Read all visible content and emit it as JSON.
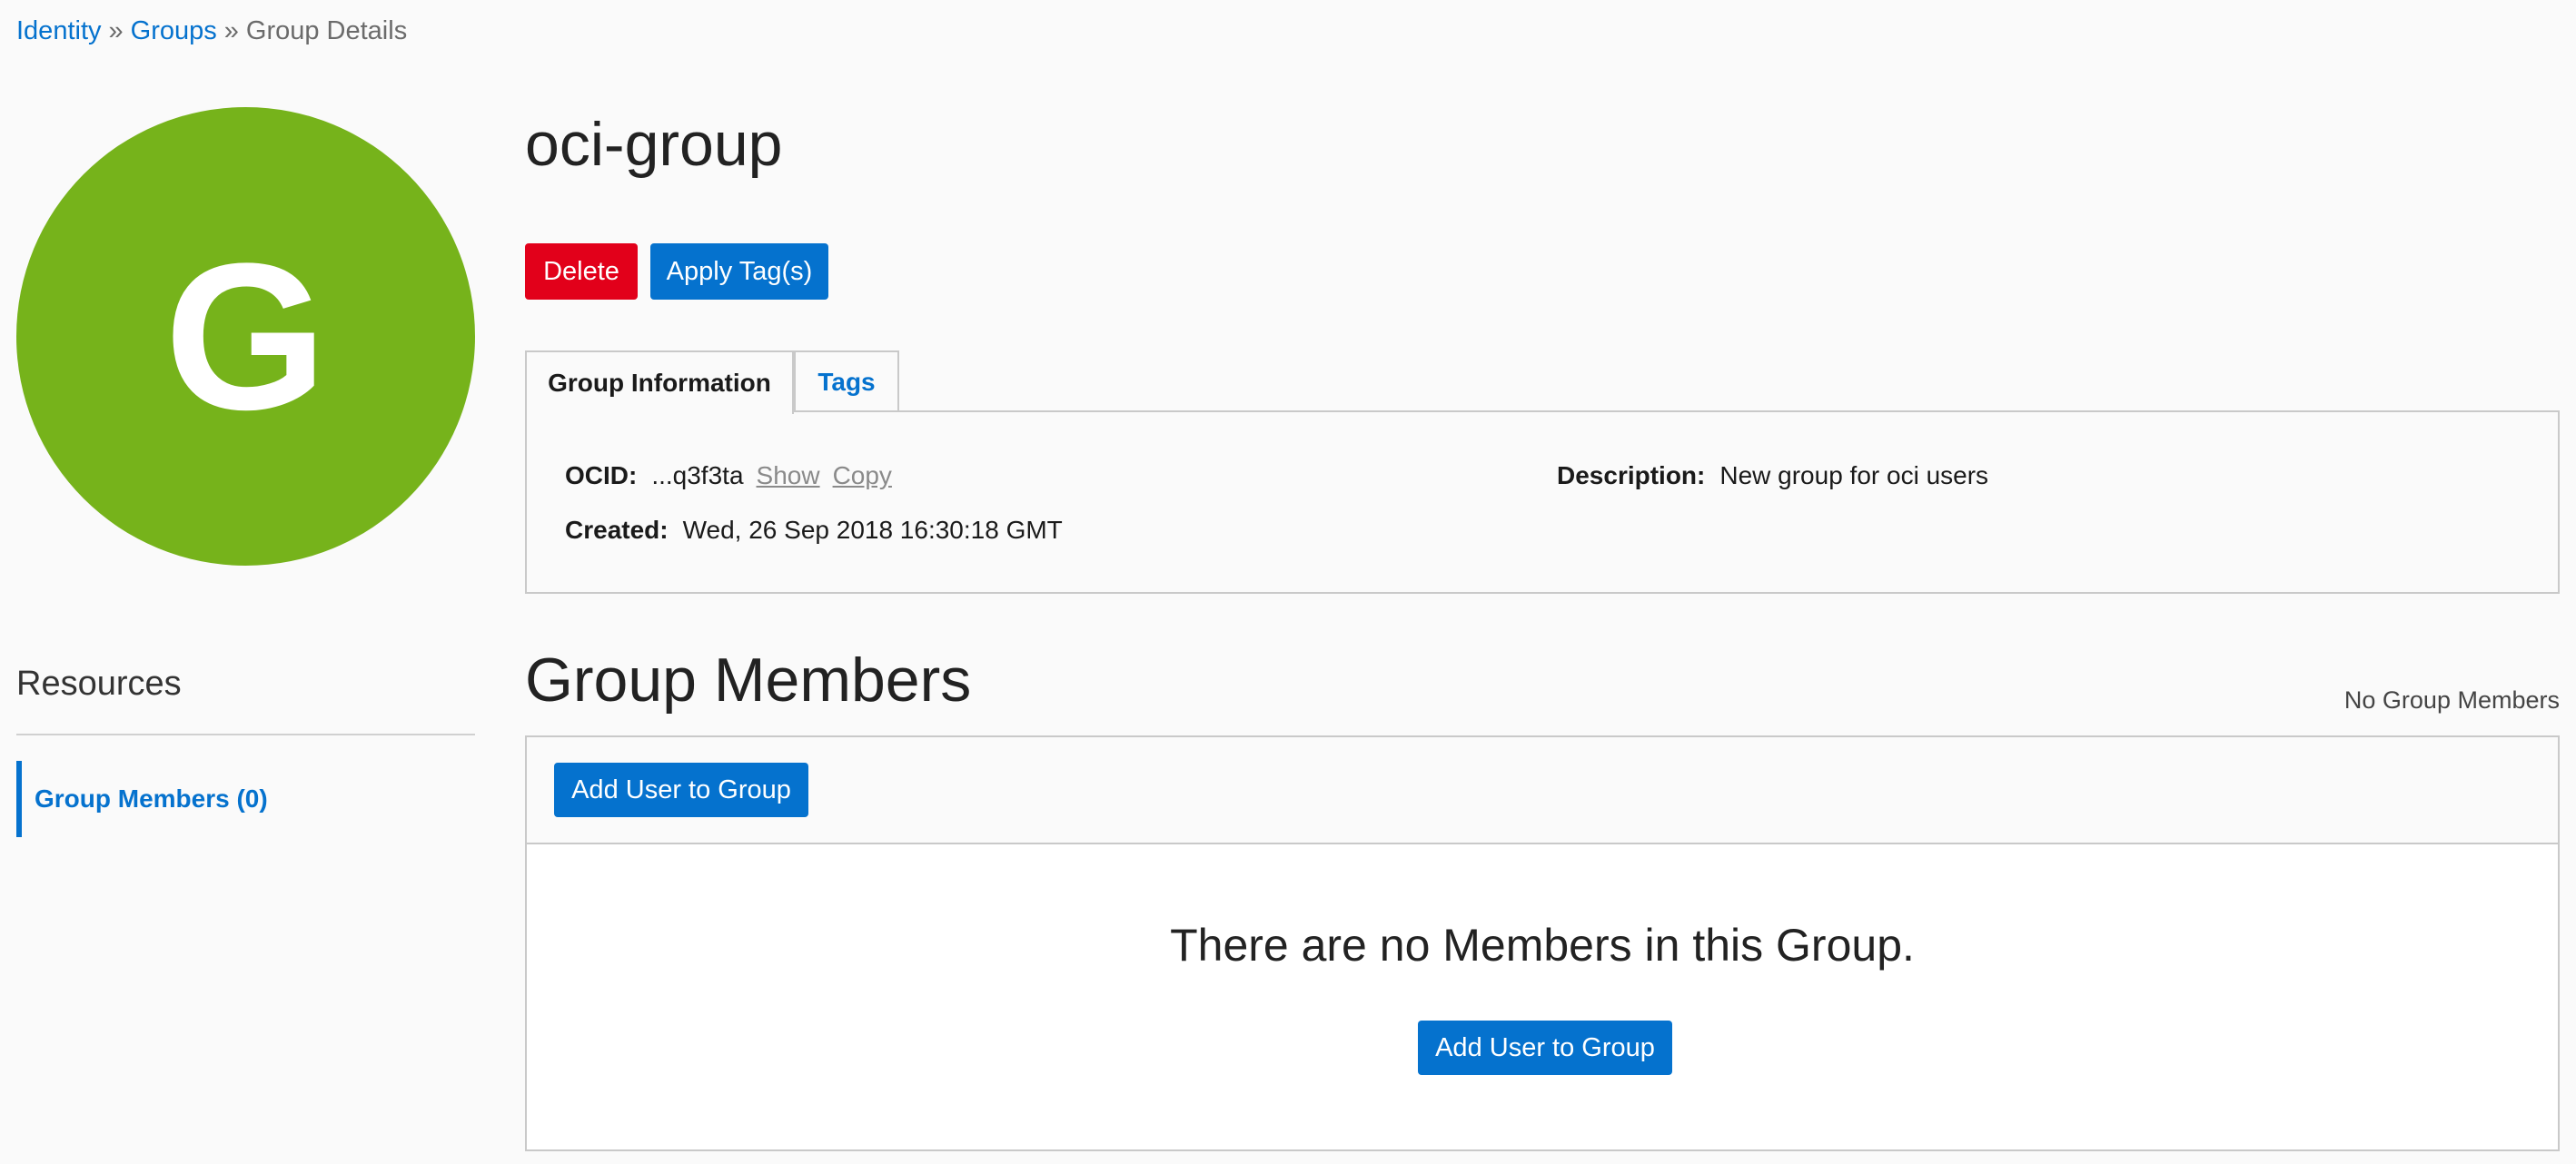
{
  "breadcrumb": {
    "items": [
      "Identity",
      "Groups",
      "Group Details"
    ],
    "separator": "»"
  },
  "avatar": {
    "letter": "G",
    "color": "#76b31b"
  },
  "header": {
    "title": "oci-group"
  },
  "actions": {
    "delete_label": "Delete",
    "apply_tags_label": "Apply Tag(s)"
  },
  "tabs": [
    {
      "label": "Group Information",
      "active": true
    },
    {
      "label": "Tags",
      "active": false
    }
  ],
  "info": {
    "ocid_label": "OCID:",
    "ocid_value": "...q3f3ta",
    "show_label": "Show",
    "copy_label": "Copy",
    "created_label": "Created:",
    "created_value": "Wed, 26 Sep 2018 16:30:18 GMT",
    "description_label": "Description:",
    "description_value": "New group for oci users"
  },
  "resources": {
    "title": "Resources",
    "items": [
      {
        "label": "Group Members (0)",
        "active": true
      }
    ]
  },
  "members": {
    "title": "Group Members",
    "count_text": "No Group Members",
    "add_button_label": "Add User to Group",
    "empty_message": "There are no Members in this Group.",
    "empty_add_button_label": "Add User to Group"
  },
  "colors": {
    "accent": "#0572ce",
    "danger": "#e2001a",
    "avatar": "#76b31b"
  }
}
